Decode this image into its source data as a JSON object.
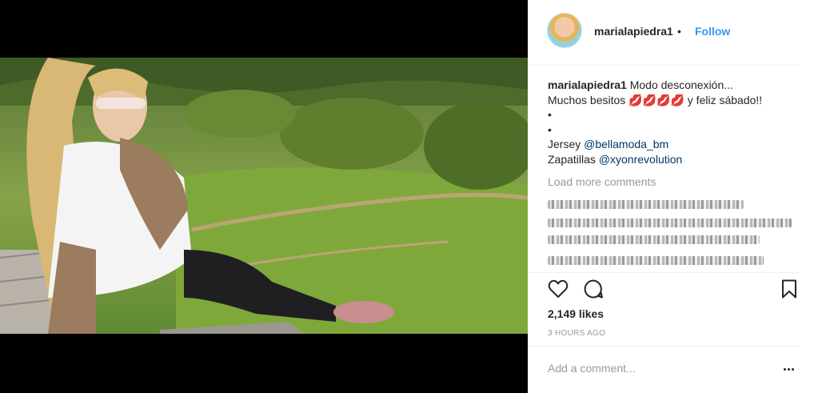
{
  "post": {
    "username": "marialapiedra1",
    "follow_label": "Follow",
    "separator": "•",
    "caption": {
      "line1": "Modo desconexión...",
      "line2_prefix": "Muchos besitos ",
      "emoji": "💋💋💋💋",
      "line2_suffix": " y feliz sábado!!",
      "bullet1": "•",
      "bullet2": "•",
      "jersey_label": "Jersey ",
      "jersey_tag": "@bellamoda_bm",
      "shoes_label": "Zapatillas ",
      "shoes_tag": "@xyonrevolution"
    },
    "load_more": "Load more comments",
    "likes": "2,149 likes",
    "timestamp": "3 HOURS AGO",
    "comment_placeholder": "Add a comment...",
    "icons": {
      "like": "heart-icon",
      "comment": "comment-icon",
      "save": "bookmark-icon",
      "tag": "user-tag-icon",
      "more": "more-options-icon"
    }
  }
}
